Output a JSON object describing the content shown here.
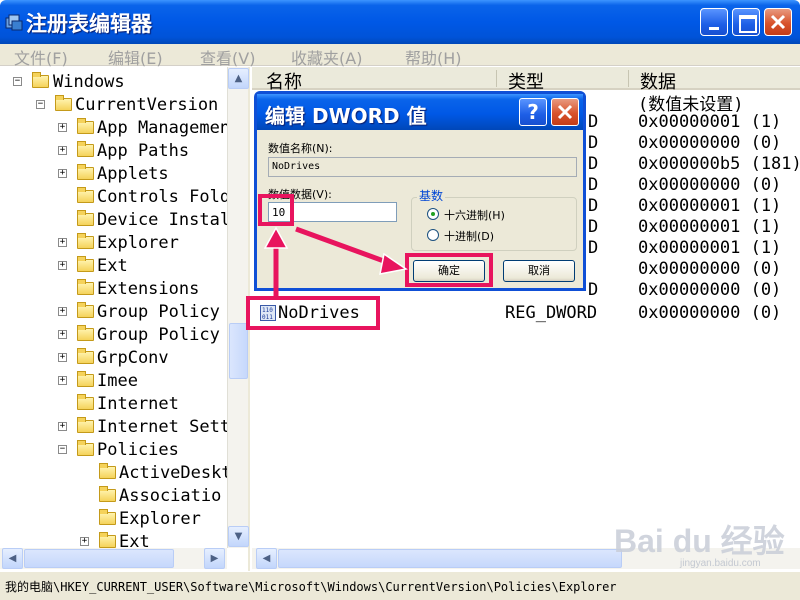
{
  "window": {
    "title": "注册表编辑器",
    "title_color": "#0058e6"
  },
  "menu": {
    "file": "文件(F)",
    "edit": "编辑(E)",
    "view": "查看(V)",
    "favorites": "收藏夹(A)",
    "help": "帮助(H)"
  },
  "tree": {
    "items": [
      {
        "label": "Windows",
        "expander": "−"
      },
      {
        "label": "CurrentVersion",
        "expander": "−"
      },
      {
        "label": "App Managemen",
        "expander": "+"
      },
      {
        "label": "App Paths",
        "expander": "+"
      },
      {
        "label": "Applets",
        "expander": "+"
      },
      {
        "label": "Controls Fold",
        "expander": ""
      },
      {
        "label": "Device Instal",
        "expander": ""
      },
      {
        "label": "Explorer",
        "expander": "+"
      },
      {
        "label": "Ext",
        "expander": "+"
      },
      {
        "label": "Extensions",
        "expander": ""
      },
      {
        "label": "Group Policy",
        "expander": "+"
      },
      {
        "label": "Group Policy",
        "expander": "+"
      },
      {
        "label": "GrpConv",
        "expander": "+"
      },
      {
        "label": "Imee",
        "expander": "+"
      },
      {
        "label": "Internet",
        "expander": ""
      },
      {
        "label": "Internet Sett",
        "expander": "+"
      },
      {
        "label": "Policies",
        "expander": "−"
      },
      {
        "label": "ActiveDeskt",
        "expander": ""
      },
      {
        "label": "Associatio",
        "expander": ""
      },
      {
        "label": "Explorer",
        "expander": ""
      },
      {
        "label": "Ext",
        "expander": "+"
      }
    ]
  },
  "list": {
    "columns": {
      "name": "名称",
      "type": "类型",
      "data": "数据"
    },
    "data_rows": [
      "(数值未设置)",
      "0x00000001 (1)",
      "0x00000000 (0)",
      "0x000000b5 (181)",
      "0x00000000 (0)",
      "0x00000001 (1)",
      "0x00000001 (1)",
      "0x00000001 (1)",
      "0x00000000 (0)",
      "0x00000000 (0)"
    ],
    "type_fragment": "D",
    "selected_row": {
      "name": "NoDrives",
      "type": "REG_DWORD",
      "data": "0x00000000 (0)"
    }
  },
  "status": {
    "path": "我的电脑\\HKEY_CURRENT_USER\\Software\\Microsoft\\Windows\\CurrentVersion\\Policies\\Explorer"
  },
  "dialog": {
    "title": "编辑 DWORD 值",
    "help_glyph": "?",
    "value_name_label": "数值名称(N):",
    "value_name": "NoDrives",
    "value_data_label": "数值数据(V):",
    "value_data": "10",
    "base_label": "基数",
    "radio_hex": "十六进制(H)",
    "radio_dec": "十进制(D)",
    "selected_base": "hex",
    "ok": "确定",
    "cancel": "取消"
  },
  "annotation": {
    "highlight_color": "#e8145e"
  },
  "watermark": {
    "logo": "Bai du 经验",
    "url": "jingyan.baidu.com"
  }
}
